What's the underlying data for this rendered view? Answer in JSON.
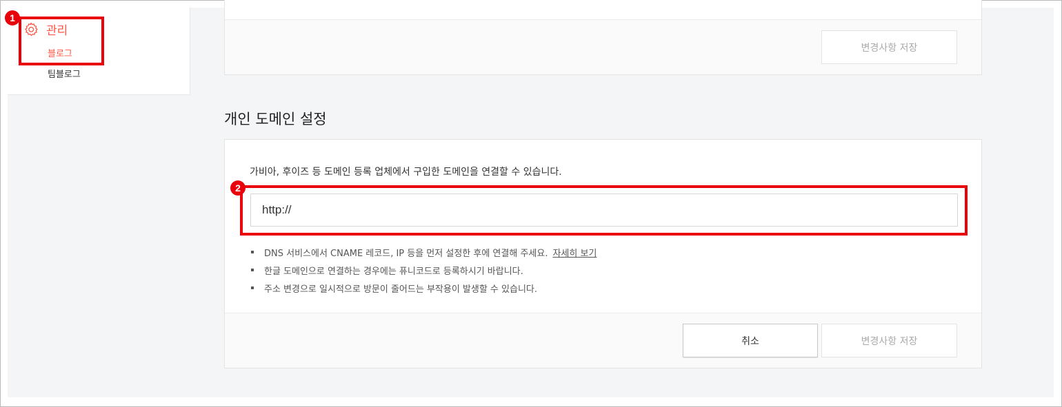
{
  "sidebar": {
    "manage_label": "관리",
    "items": [
      {
        "label": "블로그"
      },
      {
        "label": "팀블로그"
      }
    ]
  },
  "top_card": {
    "save_label": "변경사항 저장"
  },
  "domain_section": {
    "title": "개인 도메인 설정",
    "description": "가비아, 후이즈 등 도메인 등록 업체에서 구입한 도메인을 연결할 수 있습니다.",
    "url_input_value": "http://",
    "notes": [
      {
        "text": "DNS 서비스에서 CNAME 레코드, IP 등을 먼저 설정한 후에 연결해 주세요.",
        "link": "자세히 보기"
      },
      {
        "text": "한글 도메인으로 연결하는 경우에는 퓨니코드로 등록하시기 바랍니다."
      },
      {
        "text": "주소 변경으로 일시적으로 방문이 줄어드는 부작용이 발생할 수 있습니다."
      }
    ],
    "cancel_label": "취소",
    "save_label": "변경사항 저장"
  },
  "annotations": [
    {
      "number": "1"
    },
    {
      "number": "2"
    }
  ],
  "colors": {
    "accent": "#ff5544",
    "annotation_red": "#e8000b",
    "page_background": "#f4f5f7"
  }
}
